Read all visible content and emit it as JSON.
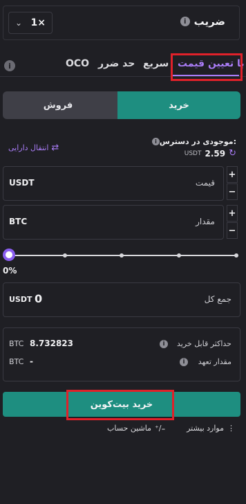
{
  "leverage": {
    "label": "ضریب",
    "value": "1×"
  },
  "tabs": [
    {
      "label": "با تعیین قیمت"
    },
    {
      "label": "سریع"
    },
    {
      "label": "حد ضرر"
    },
    {
      "label": "OCO"
    }
  ],
  "side": {
    "buy": "خرید",
    "sell": "فروش"
  },
  "available": {
    "label": "موجودی در دسترس:",
    "value": "2.59",
    "unit": "USDT",
    "transfer": "انتقال دارایی"
  },
  "price": {
    "label": "قیمت",
    "unit": "USDT"
  },
  "amount": {
    "label": "مقدار",
    "unit": "BTC"
  },
  "slider": {
    "percent_label": "0%",
    "value_percent": 0
  },
  "total": {
    "label": "جمع کل",
    "value": "0",
    "unit": "USDT"
  },
  "summary": {
    "max_buy_label": "حداکثر قابل خرید",
    "max_buy_value": "8.732823",
    "max_buy_unit": "BTC",
    "commitment_label": "مقدار تعهد",
    "commitment_value": "-",
    "commitment_unit": "BTC"
  },
  "submit": {
    "label": "خرید بیت‌کوین"
  },
  "footer": {
    "more": "موارد بیشتر",
    "calculator": "ماشین حساب"
  },
  "colors": {
    "accent": "#a97cf6",
    "buy": "#1e8e80",
    "highlight": "#e0212a"
  }
}
